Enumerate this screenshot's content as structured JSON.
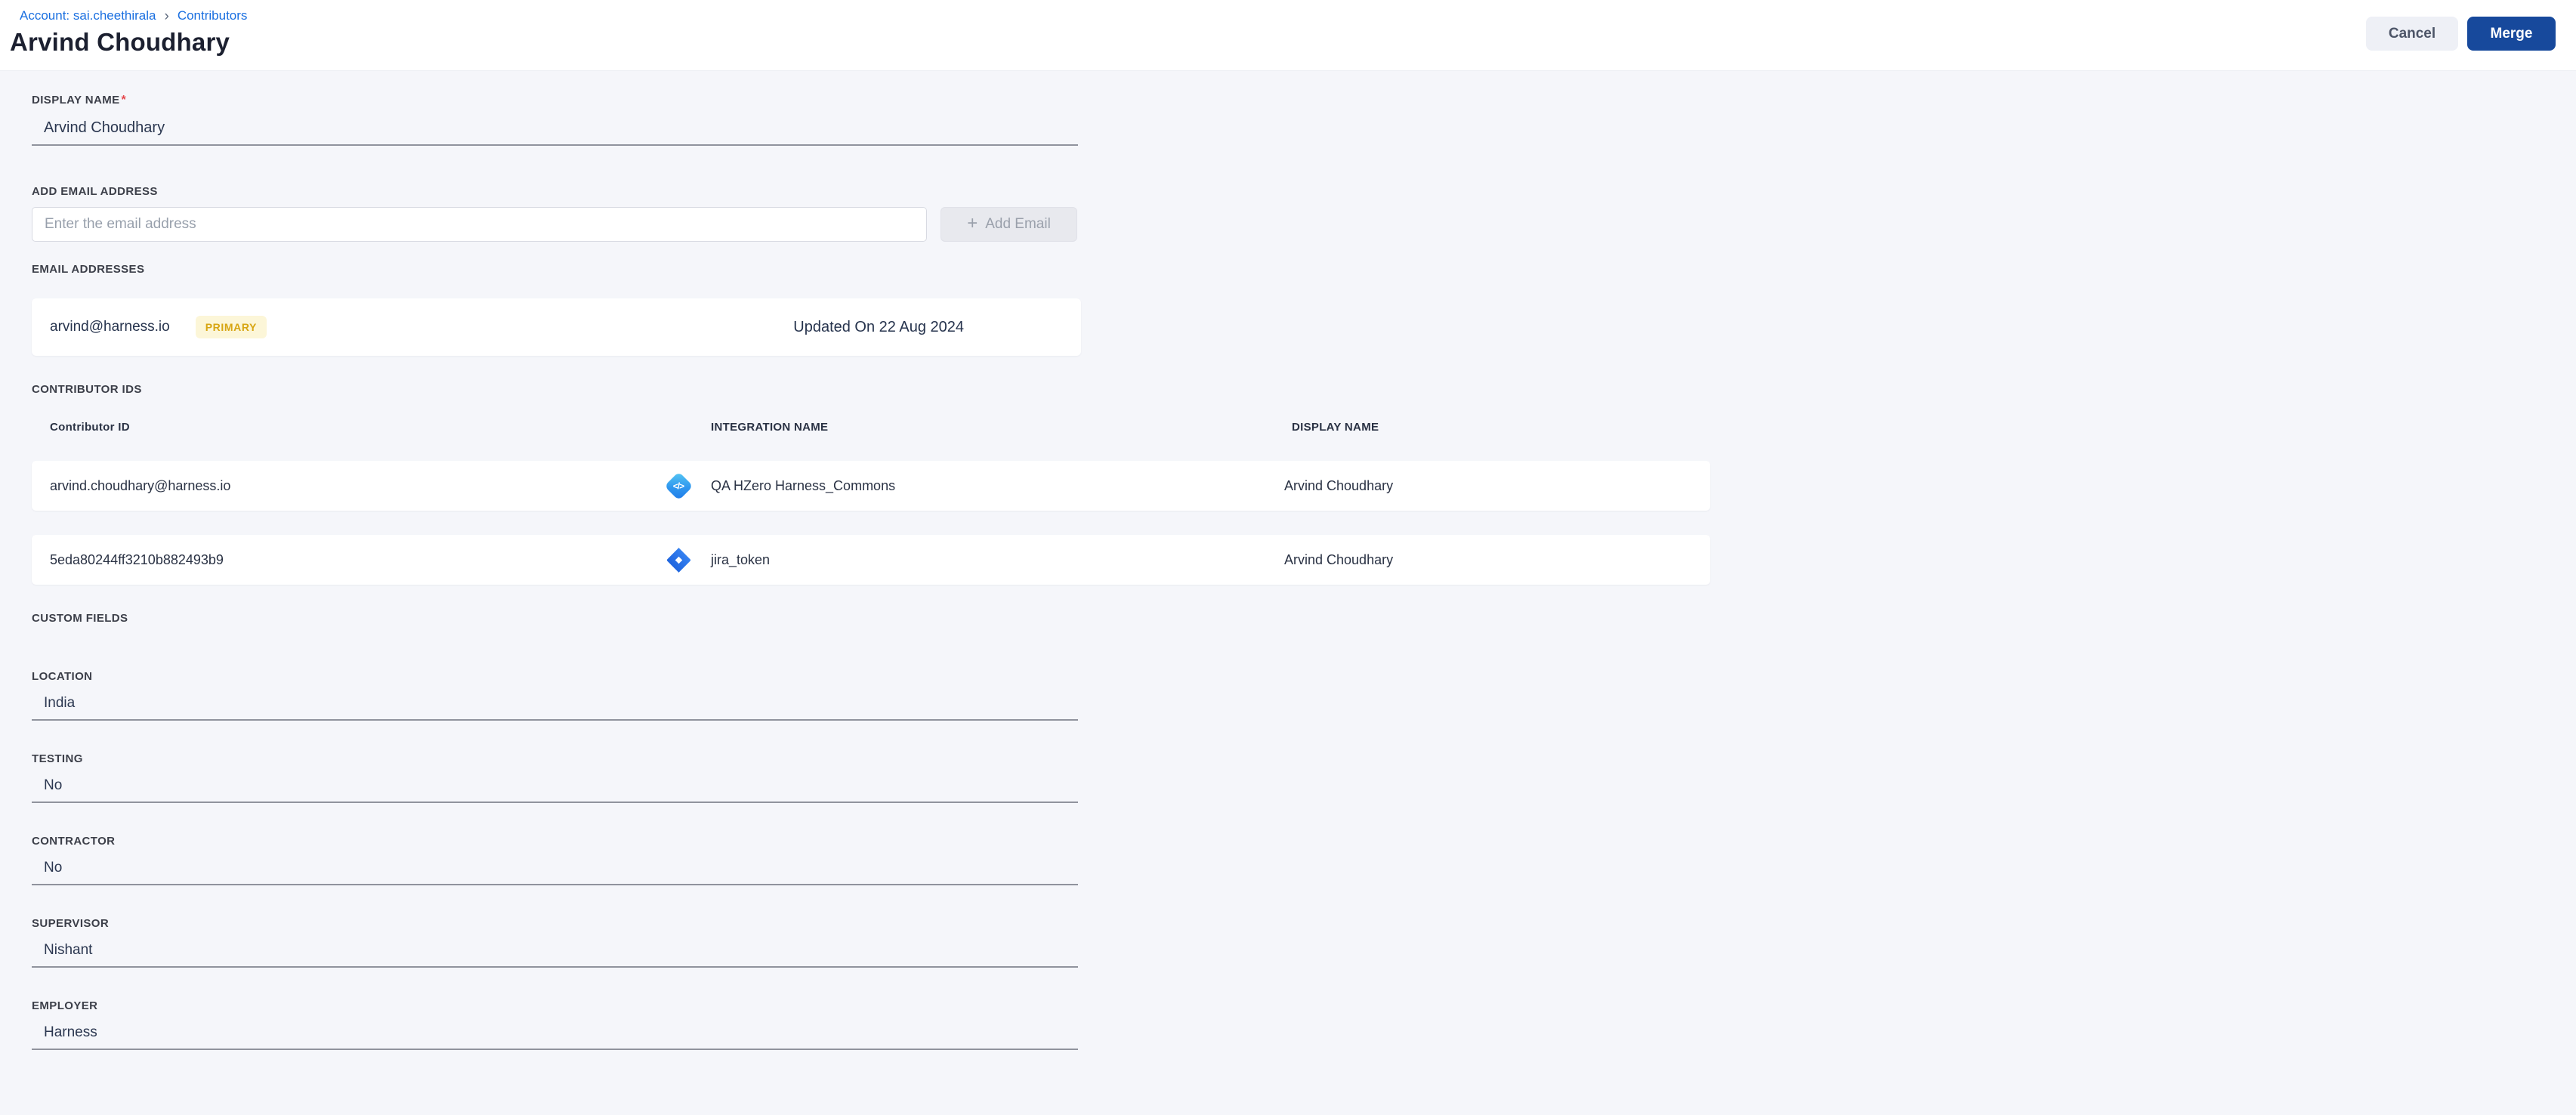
{
  "breadcrumb": {
    "account": "Account: sai.cheethirala",
    "separator": "›",
    "contributors": "Contributors"
  },
  "header": {
    "title": "Arvind Choudhary",
    "cancel_label": "Cancel",
    "merge_label": "Merge"
  },
  "display_name": {
    "label": "DISPLAY NAME",
    "required_marker": "*",
    "value": "Arvind Choudhary"
  },
  "add_email": {
    "label": "ADD EMAIL ADDRESS",
    "placeholder": "Enter the email address",
    "plus": "+",
    "button_label": "Add Email"
  },
  "email_addresses": {
    "label": "EMAIL ADDRESSES",
    "rows": [
      {
        "email": "arvind@harness.io",
        "badge": "PRIMARY",
        "updated": "Updated On 22 Aug 2024"
      }
    ]
  },
  "contributor_ids": {
    "label": "CONTRIBUTOR IDS",
    "columns": [
      "Contributor ID",
      "INTEGRATION NAME",
      "DISPLAY NAME"
    ],
    "rows": [
      {
        "id": "arvind.choudhary@harness.io",
        "integration": "QA HZero Harness_Commons",
        "icon": "code-integration-icon",
        "display_name": "Arvind Choudhary"
      },
      {
        "id": "5eda80244ff3210b882493b9",
        "integration": "jira_token",
        "icon": "jira-icon",
        "display_name": "Arvind Choudhary"
      }
    ]
  },
  "custom_fields": {
    "label": "CUSTOM FIELDS",
    "fields": [
      {
        "label": "LOCATION",
        "value": "India"
      },
      {
        "label": "TESTING",
        "value": "No"
      },
      {
        "label": "CONTRACTOR",
        "value": "No"
      },
      {
        "label": "SUPERVISOR",
        "value": "Nishant"
      },
      {
        "label": "EMPLOYER",
        "value": "Harness"
      }
    ]
  },
  "icons": {
    "code_glyph": "</>"
  },
  "colors": {
    "link": "#1a6fe0",
    "primary_button": "#17499c",
    "cancel_button_bg": "#eef0f6",
    "badge_bg": "#fcf6d8",
    "badge_text": "#d7a512",
    "page_bg": "#f5f6fa",
    "required_marker": "#e5484d"
  }
}
